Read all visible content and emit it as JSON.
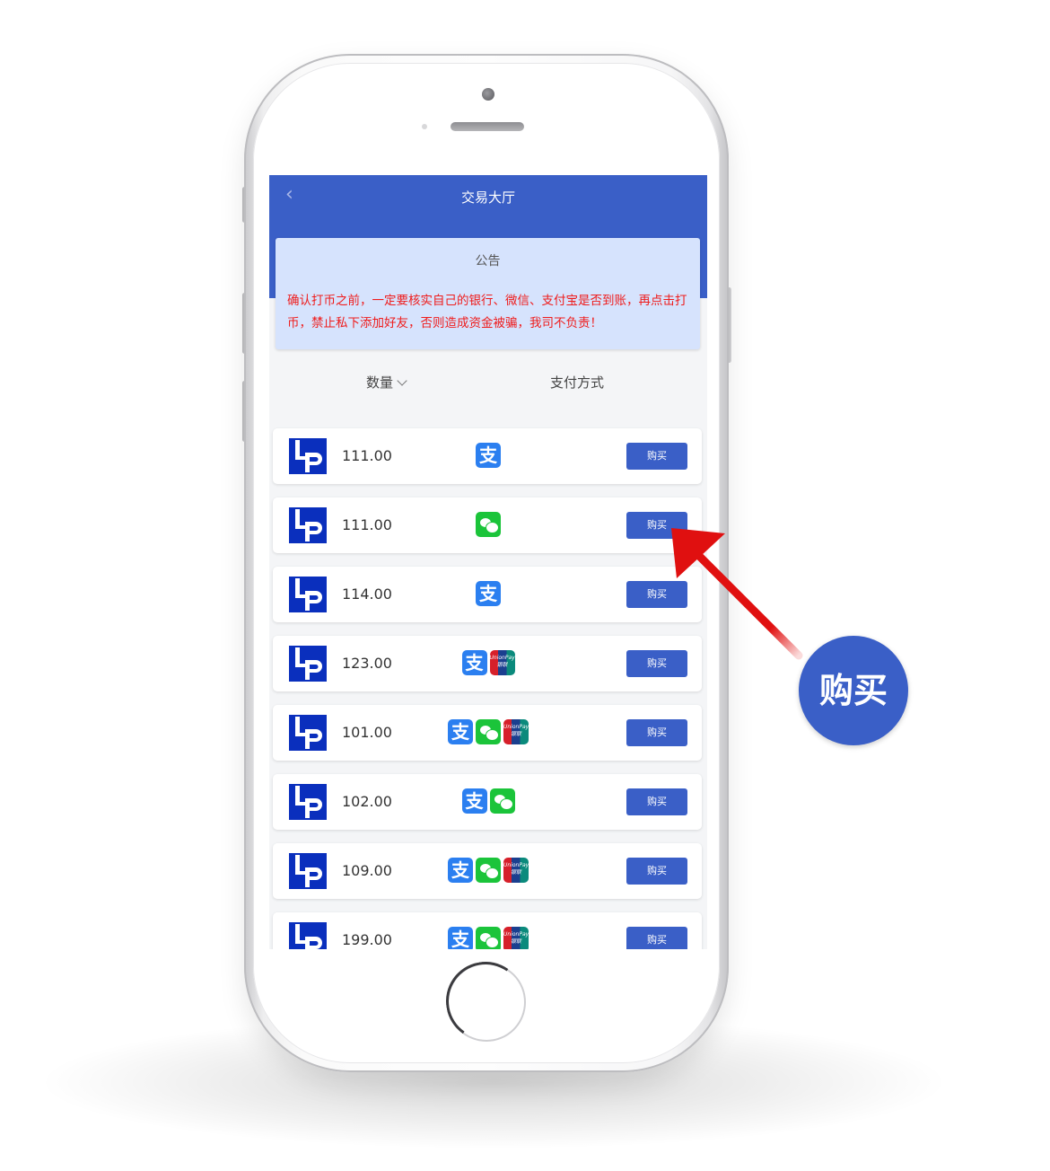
{
  "nav": {
    "back_icon": "chevron-left-icon",
    "title": "交易大厅"
  },
  "notice": {
    "title": "公告",
    "text": "确认打币之前，一定要核实自己的银行、微信、支付宝是否到账，再点击打币，禁止私下添加好友，否则造成资金被骗，我司不负责！"
  },
  "columns": {
    "quantity": "数量",
    "payment": "支付方式"
  },
  "orders": [
    {
      "amount": "111.00",
      "methods": [
        "alipay"
      ],
      "button": "购买"
    },
    {
      "amount": "111.00",
      "methods": [
        "wechat"
      ],
      "button": "购买"
    },
    {
      "amount": "114.00",
      "methods": [
        "alipay"
      ],
      "button": "购买"
    },
    {
      "amount": "123.00",
      "methods": [
        "alipay",
        "unionpay"
      ],
      "button": "购买"
    },
    {
      "amount": "101.00",
      "methods": [
        "alipay",
        "wechat",
        "unionpay"
      ],
      "button": "购买"
    },
    {
      "amount": "102.00",
      "methods": [
        "alipay",
        "wechat"
      ],
      "button": "购买"
    },
    {
      "amount": "109.00",
      "methods": [
        "alipay",
        "wechat",
        "unionpay"
      ],
      "button": "购买"
    },
    {
      "amount": "199.00",
      "methods": [
        "alipay",
        "wechat",
        "unionpay"
      ],
      "button": "购买"
    }
  ],
  "icons": {
    "alipay": "支",
    "unionpay": "UnionPay 银联"
  },
  "callout": {
    "label": "购买"
  },
  "colors": {
    "brand_blue": "#3a5fc7",
    "notice_bg": "#d6e3fd",
    "warning_red": "#ef1c1c",
    "alipay_blue": "#2b7ff0",
    "wechat_green": "#1bc43a",
    "arrow_red": "#e01010"
  }
}
